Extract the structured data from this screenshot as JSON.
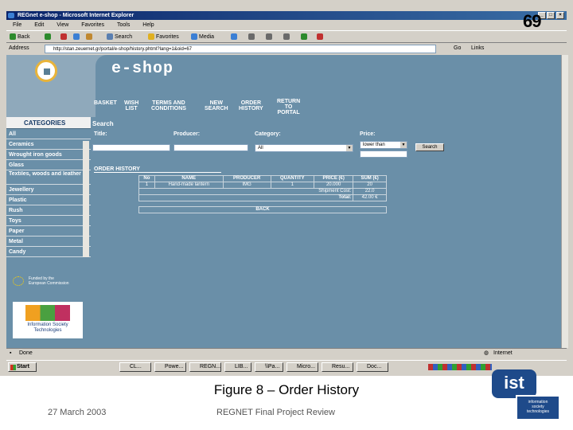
{
  "window": {
    "title": "REGnet e-shop - Microsoft Internet Explorer",
    "minimize": "_",
    "maximize": "□",
    "close": "×"
  },
  "slide_number": "69",
  "menu": [
    "File",
    "Edit",
    "View",
    "Favorites",
    "Tools",
    "Help"
  ],
  "toolbar": {
    "back": "Back",
    "search": "Search",
    "favorites": "Favorites",
    "media": "Media"
  },
  "address": {
    "label": "Address",
    "url": "http://stan.zeuernet.gr/portal/e-shop/history.phtml?lang=1&oid=67",
    "go": "Go",
    "links": "Links"
  },
  "banner": {
    "logo": "e-shop"
  },
  "nav": [
    {
      "label1": "BASKET",
      "label2": ""
    },
    {
      "label1": "WISH",
      "label2": "LIST"
    },
    {
      "label1": "TERMS AND",
      "label2": "CONDITIONS"
    },
    {
      "label1": "NEW",
      "label2": "SEARCH"
    },
    {
      "label1": "ORDER",
      "label2": "HISTORY"
    },
    {
      "label1": "RETURN",
      "label2": "TO",
      "label3": "PORTAL"
    }
  ],
  "sidebar": {
    "heading": "CATEGORIES",
    "items": [
      "All",
      "Ceramics",
      "Wrought iron goods",
      "Glass",
      "Textiles, woods and leather",
      "Jewellery",
      "Plastic",
      "Rush",
      "Toys",
      "Paper",
      "Metal",
      "Candy"
    ],
    "eu_text1": "Funded by the",
    "eu_text2": "European Commission",
    "ist_logo": "Information Society Technologies"
  },
  "search": {
    "heading": "Search",
    "title_label": "Title:",
    "producer_label": "Producer:",
    "category_label": "Category:",
    "category_value": "All",
    "price_label": "Price:",
    "price_value": "lower than",
    "button": "Search"
  },
  "order": {
    "heading": "ORDER HISTORY",
    "columns": [
      "No",
      "NAME",
      "PRODUCER",
      "QUANTITY",
      "PRICE (€)",
      "SUM (€)"
    ],
    "row": [
      "1",
      "Hand-made lantern",
      "IMG",
      "1",
      "20.000",
      "20"
    ],
    "shipment_label": "Shipment Cost:",
    "shipment_value": "22.0",
    "total_label": "Total:",
    "total_value": "42.00 €",
    "back": "BACK"
  },
  "status": {
    "left": "Done",
    "right": "Internet"
  },
  "taskbar": {
    "start": "Start",
    "tasks": [
      "CL...",
      "Powe...",
      "REGN...",
      "LIB...",
      "\\\\Pa...",
      "Micro...",
      "Resu...",
      "Doc..."
    ]
  },
  "caption": "Figure 8 – Order History",
  "footer": {
    "date": "27 March 2003",
    "title": "REGNET Final Project Review"
  },
  "ist_corner": {
    "mark": "ist",
    "line1": "information",
    "line2": "society",
    "line3": "technologies"
  },
  "colors": {
    "page_bg": "#6a8fa8",
    "banner": "#8fa9bb",
    "title_bar": "#0a246a"
  }
}
